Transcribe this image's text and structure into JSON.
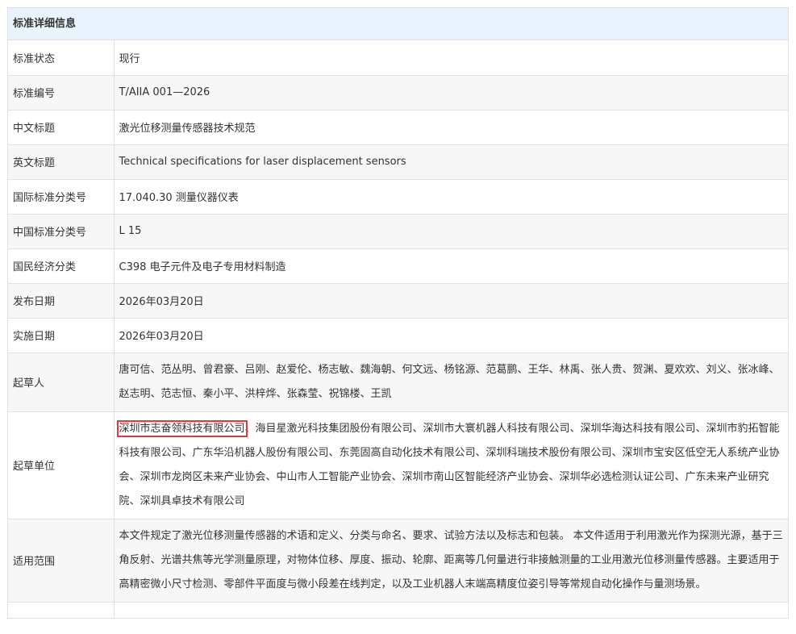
{
  "panel": {
    "title": "标准详细信息"
  },
  "rows": [
    {
      "label": "标准状态",
      "value": "现行"
    },
    {
      "label": "标准编号",
      "value": "T/AIIA 001—2026"
    },
    {
      "label": "中文标题",
      "value": "激光位移测量传感器技术规范"
    },
    {
      "label": "英文标题",
      "value": "Technical specifications for laser displacement sensors"
    },
    {
      "label": "国际标准分类号",
      "value": "17.040.30 测量仪器仪表"
    },
    {
      "label": "中国标准分类号",
      "value": "L 15"
    },
    {
      "label": "国民经济分类",
      "value": "C398 电子元件及电子专用材料制造"
    },
    {
      "label": "发布日期",
      "value": "2026年03月20日"
    },
    {
      "label": "实施日期",
      "value": "2026年03月20日"
    },
    {
      "label": "起草人",
      "value": "唐可信、范丛明、曾君豪、吕刚、赵爱伦、杨志敏、魏海朝、何文远、杨铭源、范葛鹏、王华、林禹、张人贵、贺渊、夏欢欢、刘义、张冰峰、赵志明、范志恒、秦小平、洪梓烨、张森莹、祝锦楼、王凯"
    },
    {
      "label": "起草单位",
      "highlighted": "深圳市志奋领科技有限公司",
      "value": "、海目星激光科技集团股份有限公司、深圳市大寰机器人科技有限公司、深圳华海达科技有限公司、深圳市豹拓智能科技有限公司、广东华沿机器人股份有限公司、东莞固高自动化技术有限公司、深圳科瑞技术股份有限公司、深圳市宝安区低空无人系统产业协会、深圳市龙岗区未来产业协会、中山市人工智能产业协会、深圳市南山区智能经济产业协会、深圳华必选检测认证公司、广东未来产业研究院、深圳具卓技术有限公司"
    },
    {
      "label": "适用范围",
      "value": "本文件规定了激光位移测量传感器的术语和定义、分类与命名、要求、试验方法以及标志和包装。 本文件适用于利用激光作为探测光源，基于三角反射、光谱共焦等光学测量原理，对物体位移、厚度、振动、轮廓、距离等几何量进行非接触测量的工业用激光位移测量传感器。主要适用于高精密微小尺寸检测、零部件平面度与微小段差在线判定，以及工业机器人末端高精度位姿引导等常规自动化操作与量测场景。"
    }
  ]
}
